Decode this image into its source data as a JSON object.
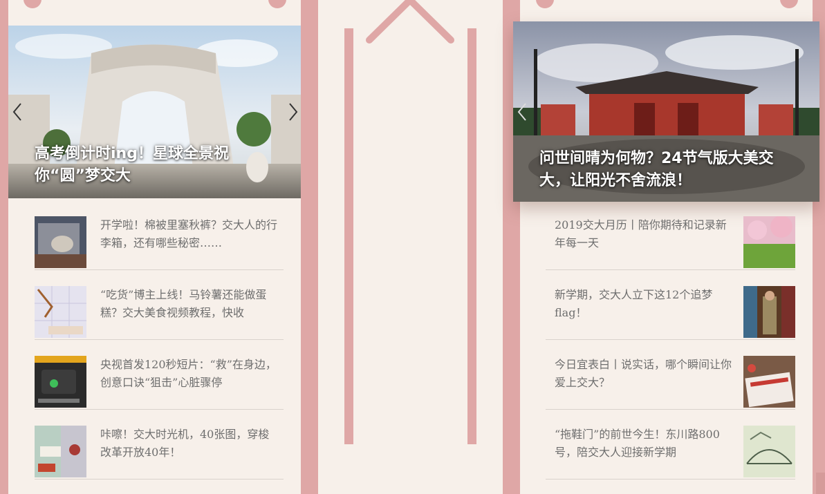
{
  "left_column": {
    "hero": {
      "title": "高考倒计时ing！星球全景祝你“圆”梦交大",
      "image": "arch-gate-panorama"
    },
    "news": [
      {
        "text": "开学啦！棉被里塞秋裤？交大人的行李箱，还有哪些秘密……",
        "image": "suitcase-thumb"
      },
      {
        "text": "“吃货”博主上线！马铃薯还能做蛋糕？交大美食视频教程，快收",
        "image": "food-thumb"
      },
      {
        "text": "央视首发120秒短片：“救”在身边，创意口诀“狙击”心脏骤停",
        "image": "cctv-thumb"
      },
      {
        "text": "咔嚓！交大时光机，40张图，穿梭改革开放40年！",
        "image": "timemachine-thumb"
      }
    ]
  },
  "right_column": {
    "hero": {
      "title": "问世间晴为何物？24节气版大美交大，让阳光不舍流浪！",
      "image": "red-gate-panorama"
    },
    "news": [
      {
        "text": "2019交大月历丨陪你期待和记录新年每一天",
        "image": "blossom-thumb"
      },
      {
        "text": "新学期，交大人立下这12个追梦flag！",
        "image": "library-thumb"
      },
      {
        "text": "今日宜表白丨说实话，哪个瞬间让你爱上交大？",
        "image": "letter-thumb"
      },
      {
        "text": "“拖鞋门”的前世今生！东川路800号，陪交大人迎接新学期",
        "image": "sketch-thumb"
      }
    ]
  },
  "colors": {
    "pink": "#dfa7a6",
    "background": "#f7f0ea",
    "text": "#6e6e6e",
    "divider": "#d9d2cc"
  }
}
